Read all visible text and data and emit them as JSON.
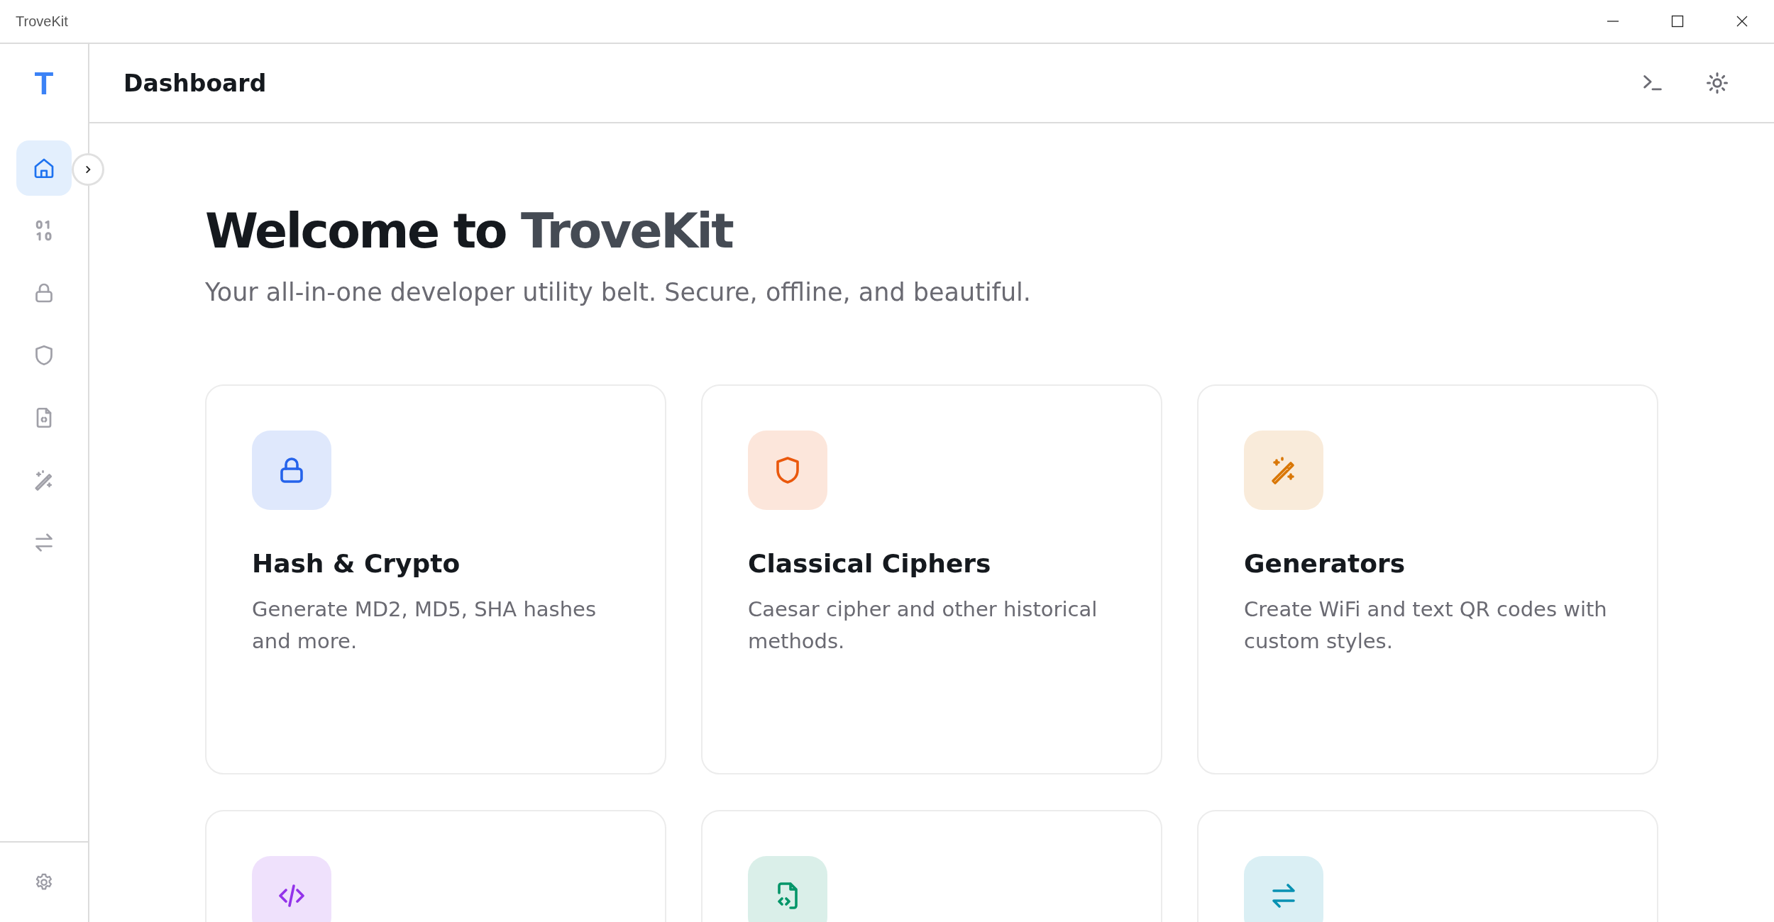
{
  "window": {
    "title": "TroveKit"
  },
  "sidebar": {
    "logo": "T",
    "items": [
      {
        "selected": true
      },
      {
        "selected": false
      },
      {
        "selected": false
      },
      {
        "selected": false
      },
      {
        "selected": false
      },
      {
        "selected": false
      },
      {
        "selected": false
      }
    ]
  },
  "header": {
    "title": "Dashboard"
  },
  "hero": {
    "lead": "Welcome to",
    "brand": "TroveKit",
    "subtitle": "Your all-in-one developer utility belt. Secure, offline, and beautiful."
  },
  "cards": [
    {
      "title": "Hash & Crypto",
      "description": "Generate MD2, MD5, SHA hashes and more.",
      "color": "#2563eb"
    },
    {
      "title": "Classical Ciphers",
      "description": "Caesar cipher and other historical methods.",
      "color": "#ea580c"
    },
    {
      "title": "Generators",
      "description": "Create WiFi and text QR codes with custom styles.",
      "color": "#d97706"
    },
    {
      "color": "#9333ea"
    },
    {
      "color": "#059669"
    },
    {
      "color": "#0891b2"
    }
  ]
}
